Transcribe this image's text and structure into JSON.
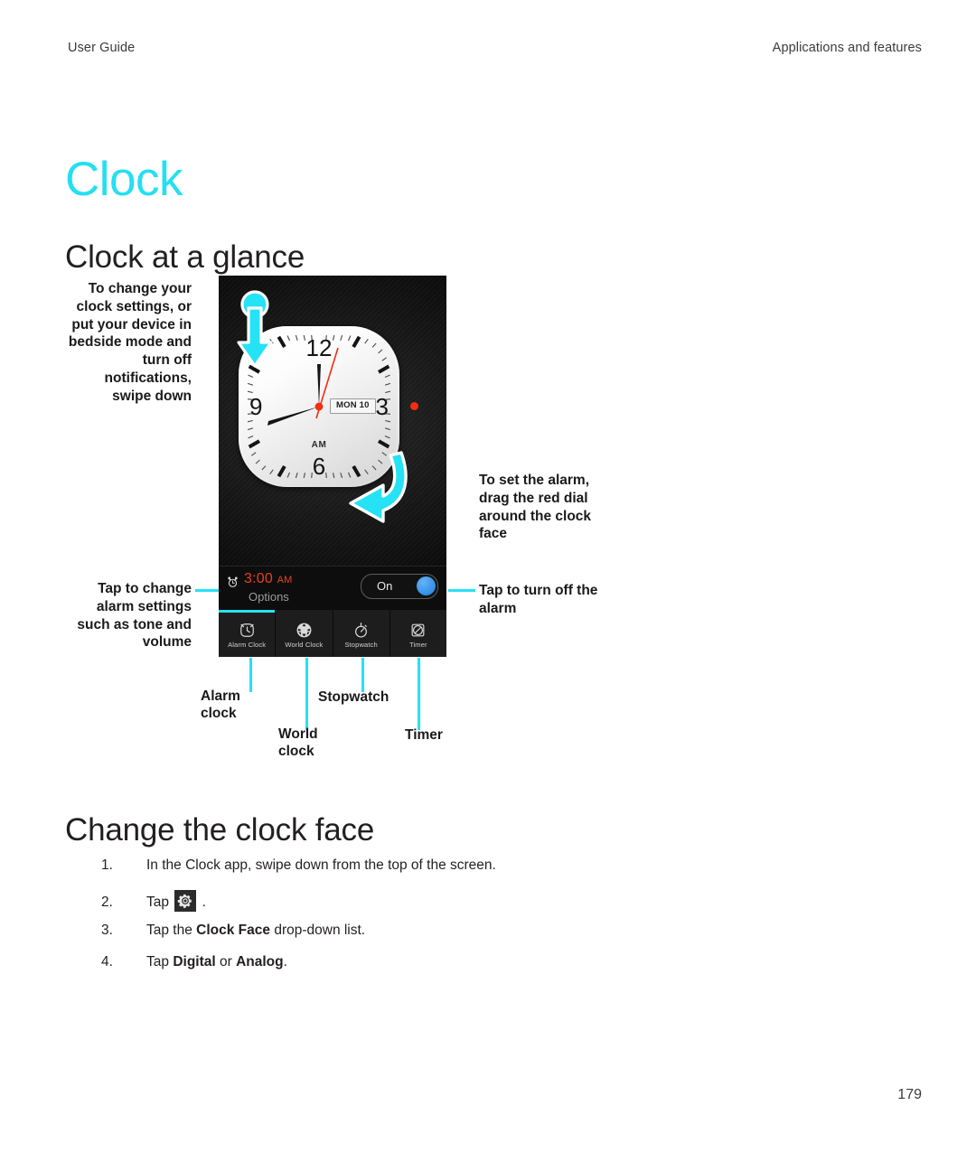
{
  "header": {
    "left": "User Guide",
    "right": "Applications and features"
  },
  "chapter_title": "Clock",
  "sections": {
    "glance": "Clock at a glance",
    "clock_face": "Change the clock face"
  },
  "figure": {
    "callouts": {
      "swipe_down": "To change your clock settings, or put your device in bedside mode and turn off notifications, swipe down",
      "set_alarm": "To set the alarm, drag the red dial around the clock face",
      "alarm_settings": "Tap to change alarm settings such as tone and volume",
      "turn_off": "Tap to turn off the alarm",
      "alarm_clock": "Alarm clock",
      "world_clock": "World clock",
      "stopwatch": "Stopwatch",
      "timer": "Timer"
    },
    "device": {
      "clock": {
        "numerals": {
          "twelve": "12",
          "three": "3",
          "six": "6",
          "nine": "9"
        },
        "date": "MON 10",
        "meridiem": "AM"
      },
      "alarm_bar": {
        "time": "3:00",
        "meridiem": "AM",
        "options_label": "Options",
        "toggle_label": "On"
      },
      "tabs": [
        {
          "label": "Alarm Clock",
          "icon": "alarm-clock-icon",
          "active": true
        },
        {
          "label": "World Clock",
          "icon": "globe-icon",
          "active": false
        },
        {
          "label": "Stopwatch",
          "icon": "stopwatch-icon",
          "active": false
        },
        {
          "label": "Timer",
          "icon": "timer-icon",
          "active": false
        }
      ]
    }
  },
  "steps": [
    {
      "num": "1.",
      "html": "In the Clock app, swipe down from the top of the screen."
    },
    {
      "num": "2.",
      "html": "Tap <span class=\"gear-chip\" data-name=\"gear-icon\" data-interactable=\"false\"><svg width=\"18\" height=\"18\" viewBox=\"0 0 24 24\" fill=\"#e8e8e8\"><path d=\"M12 8.4a3.6 3.6 0 1 0 0 7.2 3.6 3.6 0 0 0 0-7.2zm0 5.6a2 2 0 1 1 0-4 2 2 0 0 1 0 4z\"/><path d=\"M21 13.6v-3.2l-2.4-.4a6.9 6.9 0 0 0-.8-1.9l1.4-2-2.3-2.3-2 1.4a6.9 6.9 0 0 0-1.9-.8L12.6 2.5H9.4L9 4.9a6.9 6.9 0 0 0-1.9.8l-2-1.4L2.8 6.6l1.4 2a6.9 6.9 0 0 0-.8 1.9l-2.4.4v3.2l2.4.4c.2.7.5 1.3.8 1.9l-1.4 2 2.3 2.3 2-1.4c.6.3 1.2.6 1.9.8l.4 2.4h3.2l.4-2.4c.7-.2 1.3-.5 1.9-.8l2 1.4 2.3-2.3-1.4-2c.3-.6.6-1.2.8-1.9l2.4-.4zM12 17.2a5.2 5.2 0 1 1 0-10.4 5.2 5.2 0 0 1 0 10.4z\"/></svg></span> ."
    },
    {
      "num": "3.",
      "html": "Tap the <b>Clock Face</b> drop-down list."
    },
    {
      "num": "4.",
      "html": "Tap <b>Digital</b> or <b>Analog</b>."
    }
  ],
  "page_number": "179",
  "colors": {
    "accent_cyan": "#25e2f5",
    "alarm_red": "#e8411f",
    "toggle_blue": "#1d7fe0",
    "dial_red": "#f32d12"
  }
}
